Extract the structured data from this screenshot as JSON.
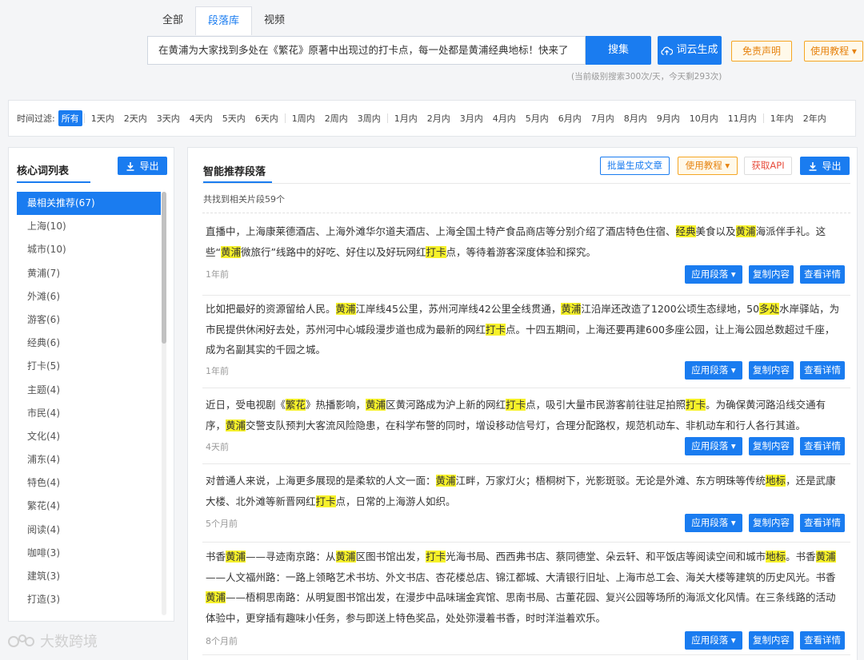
{
  "tabs": [
    {
      "label": "全部",
      "active": false
    },
    {
      "label": "段落库",
      "active": true
    },
    {
      "label": "视频",
      "active": false
    }
  ],
  "search": {
    "value": "在黄浦为大家找到多处在《繁花》原著中出现过的打卡点，每一处都是黄浦经典地标！快来了",
    "button": "搜集"
  },
  "toolbar": {
    "cloud": "词云生成",
    "disclaimer": "免责声明",
    "tutorial": "使用教程"
  },
  "quota": "(当前级别搜索300次/天，今天剩293次)",
  "filter": {
    "label": "时间过滤:",
    "items": [
      "所有",
      "1天内",
      "2天内",
      "3天内",
      "4天内",
      "5天内",
      "6天内",
      "1周内",
      "2周内",
      "3周内",
      "1月内",
      "2月内",
      "3月内",
      "4月内",
      "5月内",
      "6月内",
      "7月内",
      "8月内",
      "9月内",
      "10月内",
      "11月内",
      "1年内",
      "2年内"
    ]
  },
  "left": {
    "title": "核心词列表",
    "export": "导出",
    "keywords": [
      "最相关推荐(67)",
      "上海(10)",
      "城市(10)",
      "黄浦(7)",
      "外滩(6)",
      "游客(6)",
      "经典(6)",
      "打卡(5)",
      "主题(4)",
      "市民(4)",
      "文化(4)",
      "浦东(4)",
      "特色(4)",
      "繁花(4)",
      "阅读(4)",
      "咖啡(3)",
      "建筑(3)",
      "打造(3)"
    ]
  },
  "right": {
    "title": "智能推荐段落",
    "batch": "批量生成文章",
    "tutorial": "使用教程",
    "api": "获取API",
    "export": "导出",
    "count": "共找到相关片段59个",
    "actions": {
      "apply": "应用段落",
      "copy": "复制内容",
      "detail": "查看详情"
    },
    "paragraphs": [
      {
        "segments": [
          [
            "直播中，上海康莱德酒店、上海外滩华尔道夫酒店、上海全国土特产食品商店等分别介绍了酒店特色住宿、",
            0
          ],
          [
            "经典",
            1
          ],
          [
            "美食以及",
            0
          ],
          [
            "黄浦",
            1
          ],
          [
            "海派伴手礼。这些“",
            0
          ],
          [
            "黄浦",
            1
          ],
          [
            "微旅行”线路中的好吃、好住以及好玩网红",
            0
          ],
          [
            "打卡",
            1
          ],
          [
            "点，等待着游客深度体验和探究。",
            0
          ]
        ],
        "time": "1年前"
      },
      {
        "segments": [
          [
            "比如把最好的资源留给人民。",
            0
          ],
          [
            "黄浦",
            1
          ],
          [
            "江岸线45公里，苏州河岸线42公里全线贯通，",
            0
          ],
          [
            "黄浦",
            1
          ],
          [
            "江沿岸还改造了1200公顷生态绿地，50",
            0
          ],
          [
            "多处",
            1
          ],
          [
            "水岸驿站，为市民提供休闲好去处，苏州河中心城段漫步道也成为最新的网红",
            0
          ],
          [
            "打卡",
            1
          ],
          [
            "点。十四五期间，上海还要再建600多座公园，让上海公园总数超过千座，成为名副其实的千园之城。",
            0
          ]
        ],
        "time": "1年前"
      },
      {
        "segments": [
          [
            "近日，受电视剧《",
            0
          ],
          [
            "繁花",
            1
          ],
          [
            "》热播影响，",
            0
          ],
          [
            "黄浦",
            1
          ],
          [
            "区黄河路成为沪上新的网红",
            0
          ],
          [
            "打卡",
            1
          ],
          [
            "点，吸引大量市民游客前往驻足拍照",
            0
          ],
          [
            "打卡",
            1
          ],
          [
            "。为确保黄河路沿线交通有序，",
            0
          ],
          [
            "黄浦",
            1
          ],
          [
            "交警支队预判大客流风险隐患，在科学布警的同时，增设移动信号灯，合理分配路权，规范机动车、非机动车和行人各行其道。",
            0
          ]
        ],
        "time": "4天前"
      },
      {
        "segments": [
          [
            "对普通人来说，上海更多展现的是柔软的人文一面：",
            0
          ],
          [
            "黄浦",
            1
          ],
          [
            "江畔，万家灯火；梧桐树下，光影斑驳。无论是外滩、东方明珠等传统",
            0
          ],
          [
            "地标",
            1
          ],
          [
            "，还是武康大楼、北外滩等新晋网红",
            0
          ],
          [
            "打卡",
            1
          ],
          [
            "点，日常的上海游人如织。",
            0
          ]
        ],
        "time": "5个月前"
      },
      {
        "segments": [
          [
            "书香",
            0
          ],
          [
            "黄浦",
            1
          ],
          [
            "——寻迹南京路：从",
            0
          ],
          [
            "黄浦",
            1
          ],
          [
            "区图书馆出发，",
            0
          ],
          [
            "打卡",
            1
          ],
          [
            "光海书局、西西弗书店、蔡同德堂、朵云轩、和平饭店等阅读空间和城市",
            0
          ],
          [
            "地标",
            1
          ],
          [
            "。书香",
            0
          ],
          [
            "黄浦",
            1
          ],
          [
            "——人文福州路：一路上领略艺术书坊、外文书店、杏花楼总店、锦江都城、大清银行旧址、上海市总工会、海关大楼等建筑的历史风光。书香",
            0
          ],
          [
            "黄浦",
            1
          ],
          [
            "——梧桐思南路：从明复图书馆出发，在漫步中品味瑞金宾馆、思南书局、古董花园、复兴公园等场所的海派文化风情。在三条线路的活动体验中，更穿插有趣味小任务，参与即送上特色奖品，处处弥漫着书香，时时洋溢着欢乐。",
            0
          ]
        ],
        "time": "8个月前"
      }
    ]
  },
  "watermark": "大数跨境"
}
